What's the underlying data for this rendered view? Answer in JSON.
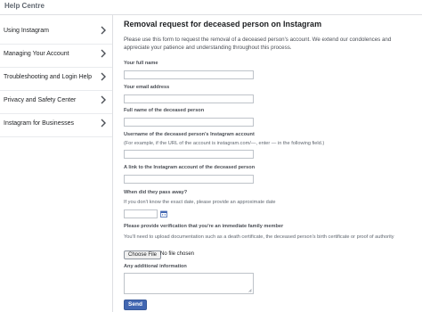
{
  "header": {
    "brand": "Help Centre"
  },
  "sidebar": {
    "items": [
      {
        "label": "Using Instagram"
      },
      {
        "label": "Managing Your Account"
      },
      {
        "label": "Troubleshooting and Login Help"
      },
      {
        "label": "Privacy and Safety Center"
      },
      {
        "label": "Instagram for Businesses"
      }
    ]
  },
  "form": {
    "title": "Removal request for deceased person on Instagram",
    "intro": "Please use this form to request the removal of a deceased person's account. We extend our condolences and appreciate your patience and understanding throughout this process.",
    "fields": {
      "full_name": {
        "label": "Your full name",
        "value": ""
      },
      "email": {
        "label": "Your email address",
        "value": ""
      },
      "deceased_name": {
        "label": "Full name of the deceased person",
        "value": ""
      },
      "username": {
        "label": "Username of the deceased person's Instagram account",
        "help": "(For example, if the URL of the account is instagram.com/—, enter — in the following field.)",
        "value": ""
      },
      "link": {
        "label": "A link to the Instagram account of the deceased person",
        "value": ""
      },
      "passed_away": {
        "label": "When did they pass away?",
        "help": "If you don't know the exact date, please provide an approximate date",
        "value": ""
      },
      "verification": {
        "label": "Please provide verification that you're an immediate family member",
        "help": "You'll need to upload documentation such as a death certificate, the deceased person's birth certificate or proof of authority",
        "button": "Choose File",
        "status": "No file chosen"
      },
      "additional": {
        "label": "Any additional information",
        "value": ""
      }
    },
    "submit": "Send"
  },
  "icons": {
    "chevron": "chevron-right-icon",
    "calendar": "calendar-icon"
  },
  "colors": {
    "accent": "#4267b2",
    "border": "#bec3c9"
  }
}
